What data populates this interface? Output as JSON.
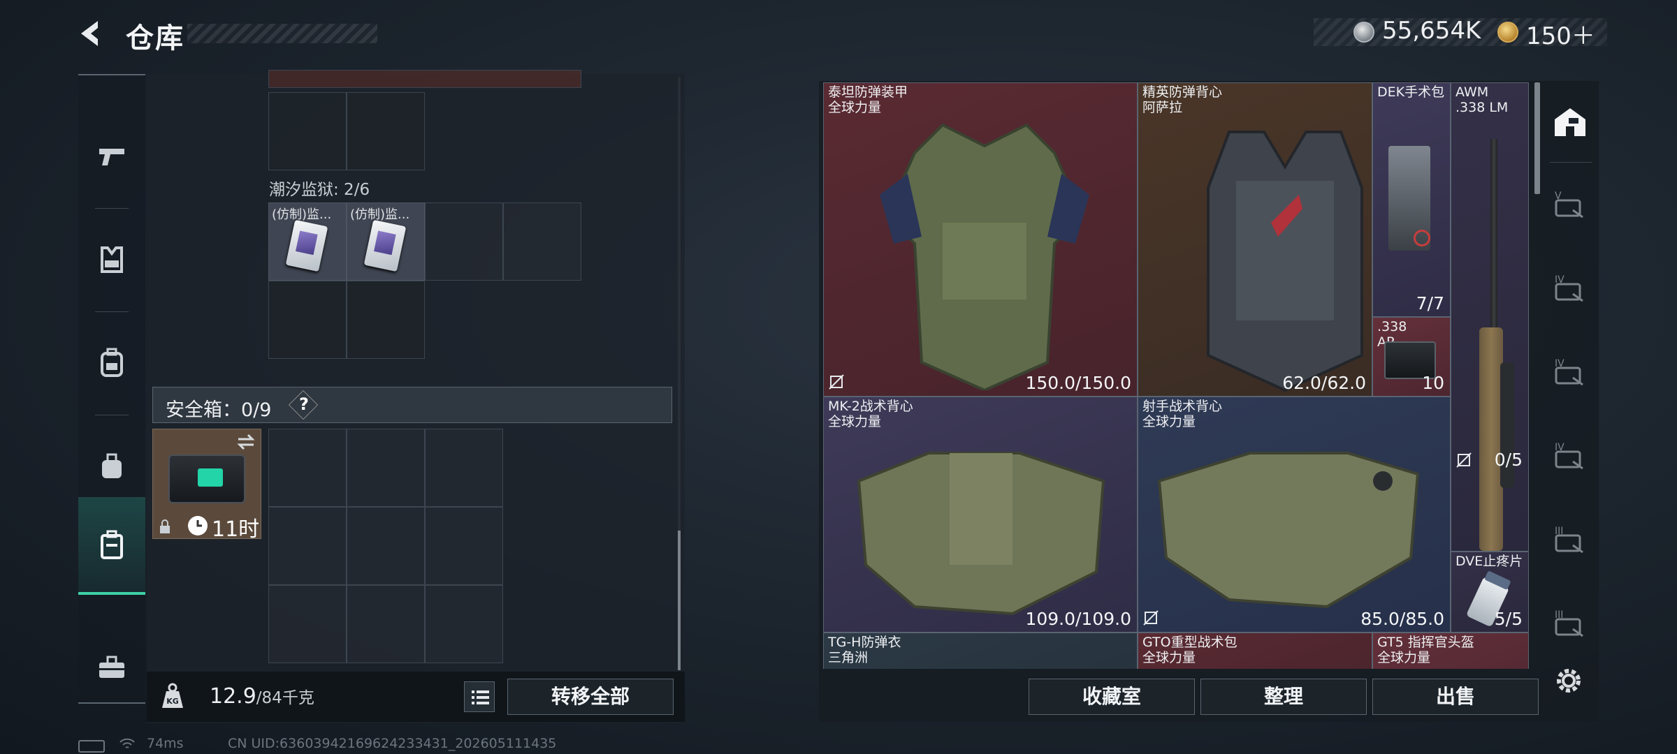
{
  "header": {
    "title": "仓库",
    "currency": {
      "silver_value": "55,654K",
      "gold_value": "150＋"
    }
  },
  "left_sidebar": {
    "items": [
      {
        "icon": "pistol-icon"
      },
      {
        "icon": "vest-icon"
      },
      {
        "icon": "backpack-icon"
      },
      {
        "icon": "pouch-icon"
      },
      {
        "icon": "safe-box-icon",
        "active": true
      },
      {
        "icon": "toolbox-icon"
      }
    ]
  },
  "storage": {
    "prison_label": "潮汐监狱: 2/6",
    "items": [
      {
        "label": "(仿制)监..."
      },
      {
        "label": "(仿制)监..."
      }
    ],
    "safe_box_label": "安全箱：0/9",
    "safe_box_help": "?",
    "safe_timer": "11时",
    "weight_current": "12.9",
    "weight_max": "/84千克",
    "transfer_all": "转移全部"
  },
  "inventory": {
    "items": [
      {
        "name": "泰坦防弹装甲",
        "sub": "全球力量",
        "durability": "150.0/150.0"
      },
      {
        "name": "精英防弹背心",
        "sub": "阿萨拉",
        "durability": "62.0/62.0"
      },
      {
        "name": "DEK手术包",
        "sub": "",
        "durability": "7/7"
      },
      {
        "name": "AWM",
        "sub": ".338 LM",
        "durability": "0/5"
      },
      {
        "name": ".338",
        "sub": "AP",
        "durability": "10"
      },
      {
        "name": "MK-2战术背心",
        "sub": "全球力量",
        "durability": "109.0/109.0"
      },
      {
        "name": "射手战术背心",
        "sub": "全球力量",
        "durability": "85.0/85.0"
      },
      {
        "name": "DVE止疼片",
        "sub": "",
        "durability": "5/5"
      },
      {
        "name": "TG-H防弹衣",
        "sub": "三角洲",
        "durability": ""
      },
      {
        "name": "GTO重型战术包",
        "sub": "全球力量",
        "durability": ""
      },
      {
        "name": "GT5 指挥官头盔",
        "sub": "全球力量",
        "durability": ""
      }
    ]
  },
  "right_sidebar": {
    "filters": [
      "home-icon",
      "armor-v-icon",
      "armor-iv-icon",
      "armor-iv-icon",
      "armor-iv-icon",
      "armor-iii-icon",
      "armor-iii-icon"
    ],
    "level_labels": [
      "V",
      "IV",
      "IV",
      "IV",
      "III",
      "III"
    ]
  },
  "actions": {
    "collection": "收藏室",
    "organize": "整理",
    "sell": "出售"
  },
  "status": {
    "ping": "74ms",
    "uid": "CN UID:63603942169624233431_202605111435"
  },
  "colors": {
    "accent": "#3fd1a6",
    "red_slot": "#5a2a32",
    "navy_slot": "#2f3a55"
  }
}
